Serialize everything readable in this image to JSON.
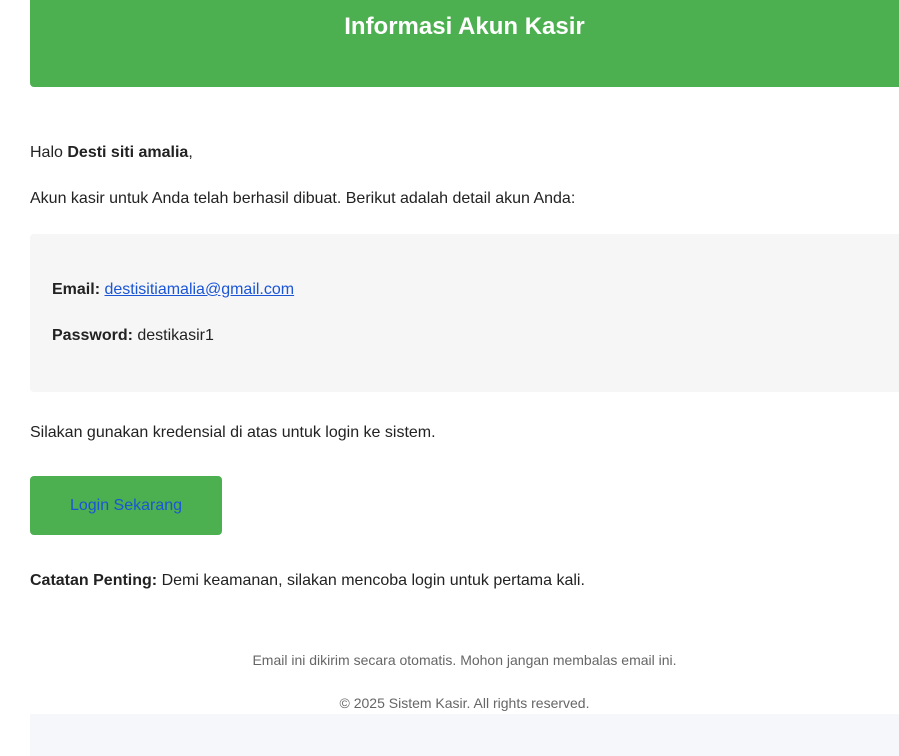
{
  "header": {
    "title": "Informasi Akun Kasir"
  },
  "greeting": {
    "prefix": "Halo ",
    "name": "Desti siti amalia",
    "suffix": ","
  },
  "intro": "Akun kasir untuk Anda telah berhasil dibuat. Berikut adalah detail akun Anda:",
  "details": {
    "email_label": "Email:",
    "email_value": "destisitiamalia@gmail.com",
    "password_label": "Password:",
    "password_value": "destikasir1"
  },
  "instruction": "Silakan gunakan kredensial di atas untuk login ke sistem.",
  "login_button": "Login Sekarang",
  "note": {
    "label": "Catatan Penting:",
    "text": " Demi keamanan, silakan mencoba login untuk pertama kali."
  },
  "footer": {
    "line1": "Email ini dikirim secara otomatis. Mohon jangan membalas email ini.",
    "line2": "© 2025 Sistem Kasir. All rights reserved."
  },
  "colors": {
    "brand_green": "#4caf50",
    "link_blue": "#1a55d6",
    "details_bg": "#f6f6f6"
  }
}
